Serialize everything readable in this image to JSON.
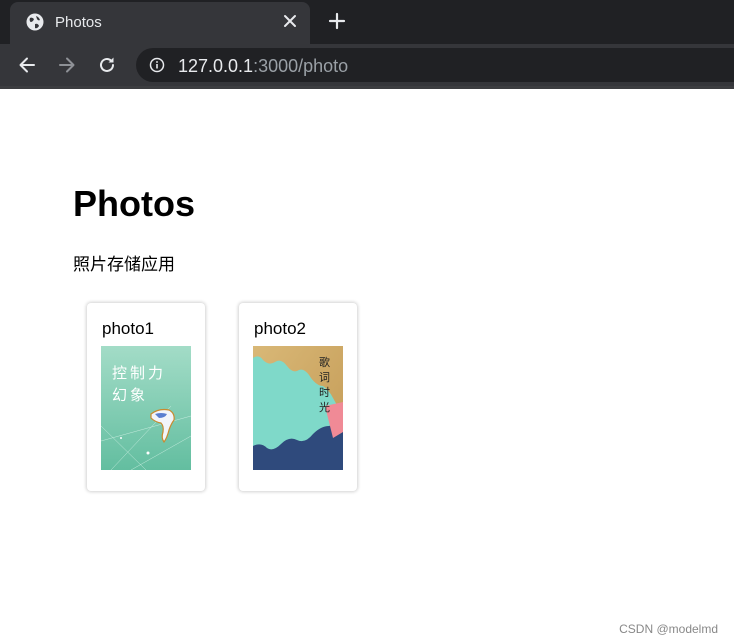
{
  "browser": {
    "tab_title": "Photos",
    "url_host": "127.0.0.1",
    "url_rest": ":3000/photo"
  },
  "page": {
    "title": "Photos",
    "subtitle": "照片存储应用"
  },
  "photos": [
    {
      "title": "photo1",
      "image_text": "控制力幻象"
    },
    {
      "title": "photo2",
      "image_text": "歌词时光"
    }
  ],
  "watermark": "CSDN @modelmd"
}
